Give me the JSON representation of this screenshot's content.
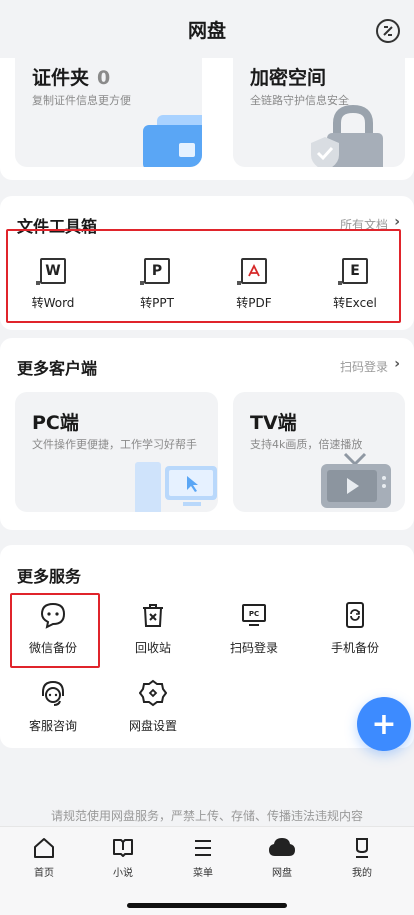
{
  "header": {
    "title": "网盘",
    "icon": "mini-program-icon"
  },
  "top_tiles": [
    {
      "title": "证件夹",
      "count": "0",
      "subtitle": "复制证件信息更方便",
      "icon": "id-card-icon"
    },
    {
      "title": "加密空间",
      "subtitle": "全链路守护信息安全",
      "icon": "lock-icon"
    }
  ],
  "toolbox": {
    "title": "文件工具箱",
    "link": "所有文档",
    "tools": [
      {
        "label": "转Word",
        "glyph": "W",
        "icon": "word-file-icon"
      },
      {
        "label": "转PPT",
        "glyph": "P",
        "icon": "ppt-file-icon"
      },
      {
        "label": "转PDF",
        "glyph": "⅄",
        "icon": "pdf-file-icon"
      },
      {
        "label": "转Excel",
        "glyph": "E",
        "icon": "excel-file-icon"
      }
    ]
  },
  "clients": {
    "title": "更多客户端",
    "link": "扫码登录",
    "tiles": [
      {
        "title": "PC端",
        "subtitle": "文件操作更便捷，工作学习好帮手",
        "icon": "pc-icon"
      },
      {
        "title": "TV端",
        "subtitle": "支持4k画质，倍速播放",
        "icon": "tv-icon"
      }
    ]
  },
  "services": {
    "title": "更多服务",
    "items": [
      {
        "label": "微信备份",
        "icon": "wechat-chat-icon"
      },
      {
        "label": "回收站",
        "icon": "trash-icon"
      },
      {
        "label": "扫码登录",
        "icon": "pc-scan-icon"
      },
      {
        "label": "手机备份",
        "icon": "phone-backup-icon"
      },
      {
        "label": "客服咨询",
        "icon": "headset-icon"
      },
      {
        "label": "网盘设置",
        "icon": "settings-gear-icon"
      }
    ]
  },
  "fab": {
    "label": "+"
  },
  "notice": "请规范使用网盘服务，严禁上传、存储、传播违法违规内容",
  "bottom_nav": [
    {
      "label": "首页",
      "icon": "home-icon"
    },
    {
      "label": "小说",
      "icon": "book-icon"
    },
    {
      "label": "菜单",
      "icon": "menu-icon"
    },
    {
      "label": "网盘",
      "icon": "cloud-icon",
      "active": true
    },
    {
      "label": "我的",
      "icon": "profile-icon"
    }
  ],
  "colors": {
    "accent": "#3d8bff",
    "highlight": "#e0242b",
    "tile_bg": "#f2f3f5"
  }
}
